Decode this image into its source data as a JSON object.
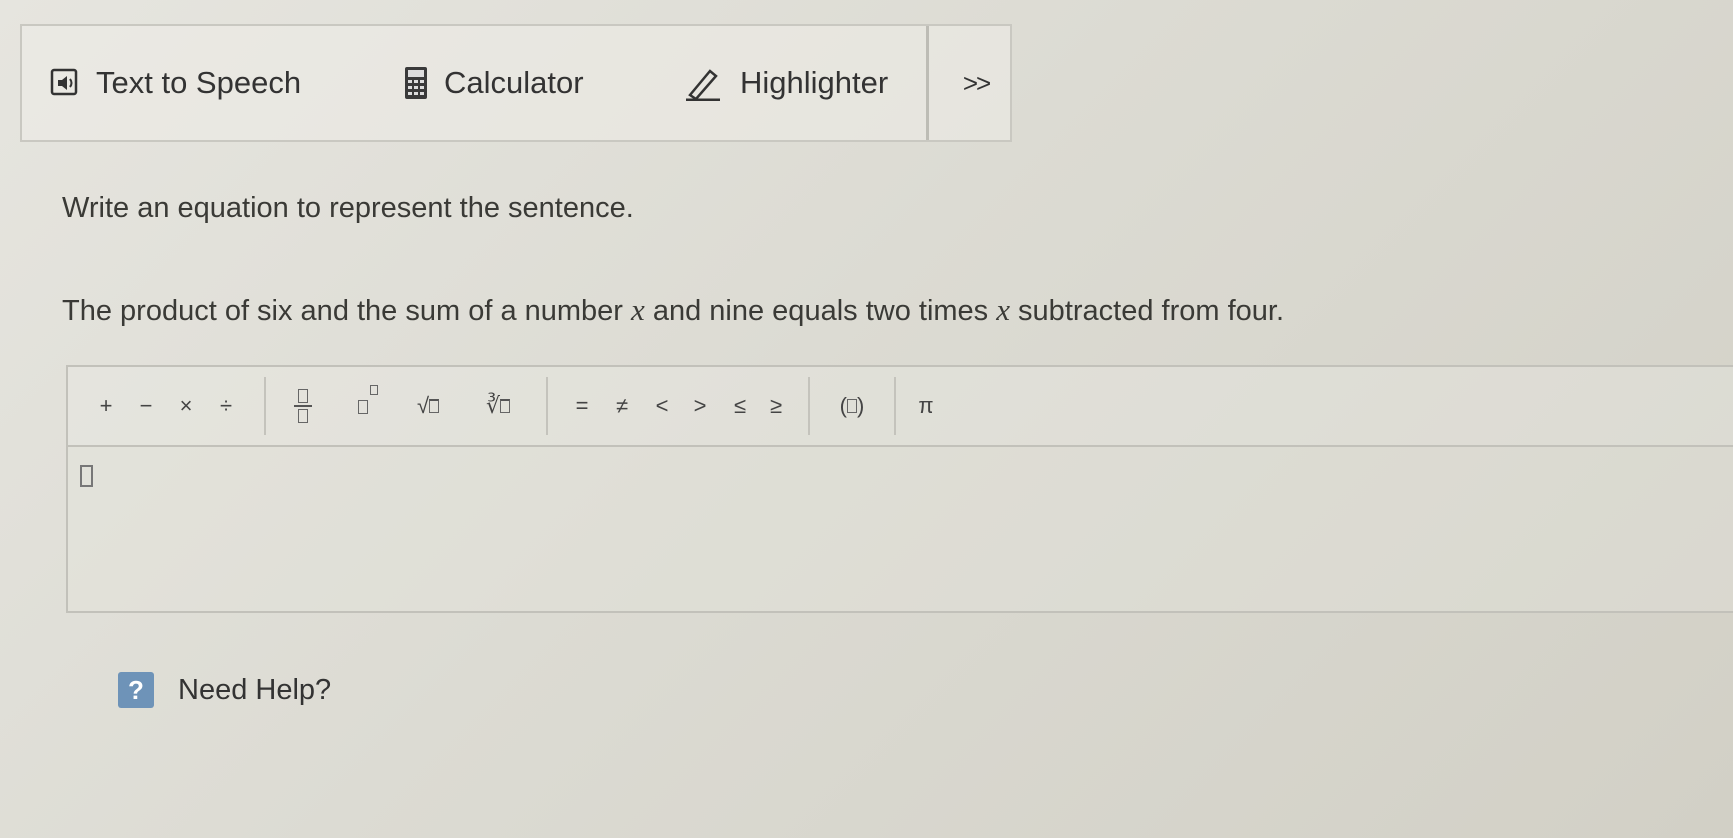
{
  "toolbar": {
    "text_to_speech": "Text to Speech",
    "calculator": "Calculator",
    "highlighter": "Highlighter",
    "more": ">>"
  },
  "prompt": "Write an equation to represent the sentence.",
  "question": {
    "part1": "The product of six and the sum of a number ",
    "var1": "x",
    "part2": " and nine equals two times ",
    "var2": "x",
    "part3": " subtracted from four."
  },
  "palette": {
    "plus": "+",
    "minus": "−",
    "times": "×",
    "divide": "÷",
    "sqrt": "√",
    "nthroot": "∛",
    "equals": "=",
    "not_equal": "≠",
    "less": "<",
    "greater": ">",
    "less_equal": "≤",
    "greater_equal": "≥",
    "paren_open": "(",
    "paren_close": ")",
    "pi": "π"
  },
  "help": {
    "icon_text": "?",
    "label": "Need Help?"
  },
  "colors": {
    "help_icon": "#6e93b8",
    "background": "#dcdbd3"
  }
}
